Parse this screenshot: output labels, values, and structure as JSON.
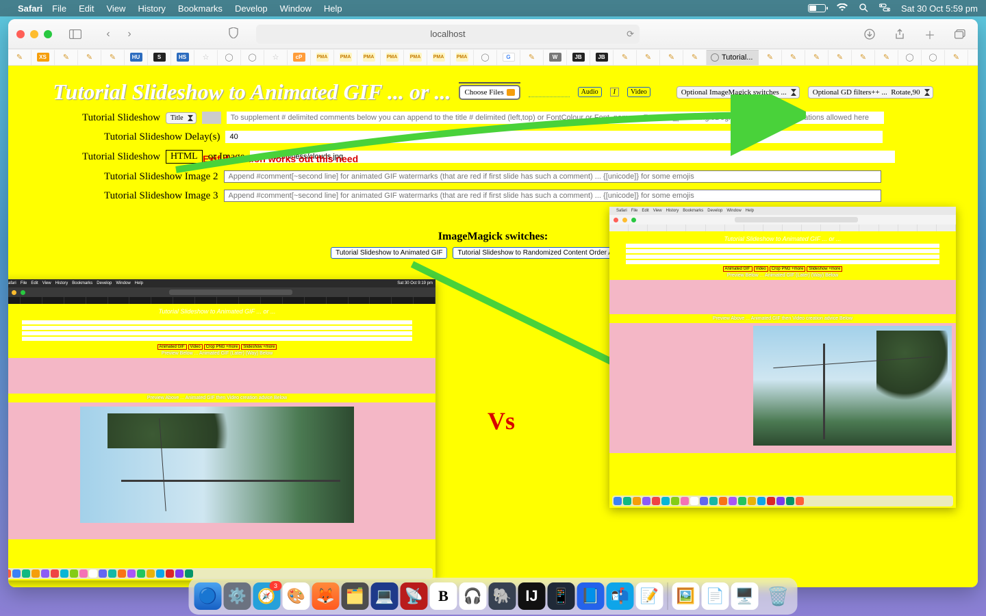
{
  "menubar": {
    "app": "Safari",
    "items": [
      "File",
      "Edit",
      "View",
      "History",
      "Bookmarks",
      "Develop",
      "Window",
      "Help"
    ],
    "clock": "Sat 30 Oct  5:59 pm"
  },
  "browser": {
    "url": "localhost",
    "active_tab": "Tutorial..."
  },
  "page": {
    "title": "Tutorial Slideshow to Animated GIF ... or ...",
    "choose_files": "Choose Files",
    "audio": "Audio",
    "video": "Video",
    "select_im": "Optional ImageMagick switches ...",
    "select_gd": "Optional GD filters++ ...",
    "select_rotate": "Rotate,90",
    "row_slideshow": "Tutorial Slideshow",
    "title_select": "Title",
    "title_placeholder": "To supplement # delimited comments below you can append to the title # delimited (left,top) or FontColour or Font_name or FontSize_px or AngleDegrees[;Opacity] configurations allowed here",
    "row_delay": "Tutorial Slideshow Delay(s)",
    "delay_value": "40",
    "row_html": "Tutorial Slideshow",
    "html_chip": "HTML",
    "or_image": "or Image",
    "image_path": "../../Mindfulness/clouds.jpg",
    "row_img2": "Tutorial Slideshow Image 2",
    "row_img3": "Tutorial Slideshow Image 3",
    "img_placeholder": "Append #comment[~second line] for animated GIF watermarks (that are red if first slide has such a comment) ... {[unicode]} for some emojis",
    "switches_heading": "ImageMagick switches:",
    "btn1": "Tutorial Slideshow to Animated GIF",
    "btn2": "Tutorial Slideshow to Randomized Content Order Animated GIF",
    "red_note": "Exif detection works out this need",
    "vs": "Vs"
  },
  "inset": {
    "clock_left": "Sat 30 Oct  9:19 pm",
    "preview_below": "Preview Below ... Animated GIF (Later) (Way) Below",
    "preview_above_left": "Preview Above ... Animated GIF then Video creation advice Below",
    "preview_above_right": "Preview Above ... Animated GIF then Video creation advice Below"
  },
  "dock_colors": [
    "#3478f6",
    "#ff6a3d",
    "#f7c948",
    "#ff4a4a",
    "#38a169",
    "#6a5acd",
    "#34c759",
    "#ff2d55",
    "#9b59b6",
    "#2b8ad6",
    "#f0932b",
    "#30c6d6",
    "#e74c3c",
    "#1abc9c",
    "#ff5e9c",
    "#8e44ad",
    "#2980b9",
    "#27ae60",
    "#d35400",
    "#c0392b",
    "#7f8c8d",
    "#16a085",
    "#f39c12",
    "#2c3e50",
    "#3498db",
    "#95a5a6",
    "#e67e22",
    "#fcfcfc"
  ]
}
